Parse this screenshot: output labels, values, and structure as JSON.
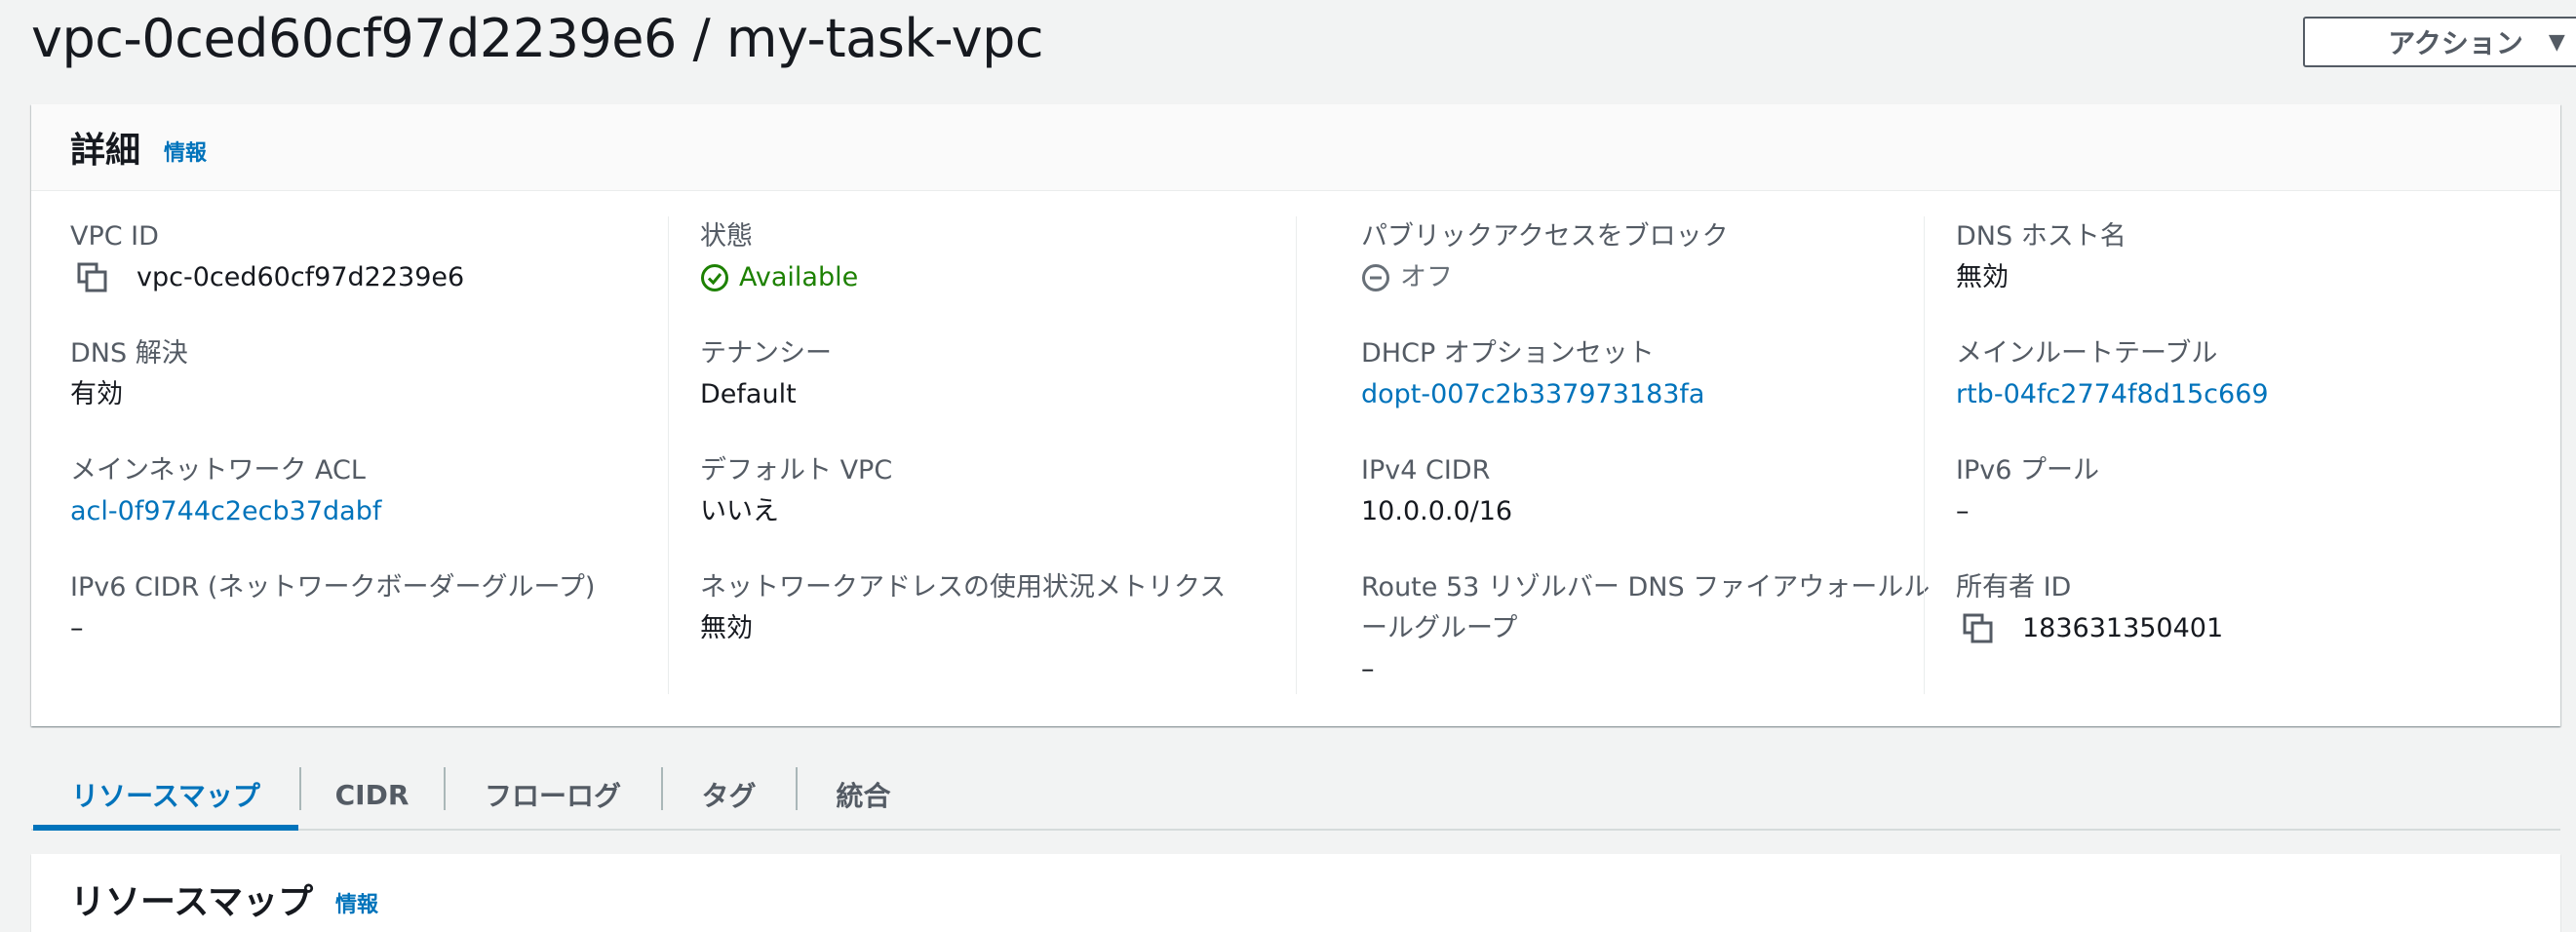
{
  "header": {
    "title": "vpc-0ced60cf97d2239e6 / my-task-vpc",
    "action_label": "アクション"
  },
  "details": {
    "title": "詳細",
    "info": "情報",
    "vpc_id": {
      "label": "VPC ID",
      "value": "vpc-0ced60cf97d2239e6"
    },
    "state": {
      "label": "状態",
      "value": "Available"
    },
    "block_public_access": {
      "label": "パブリックアクセスをブロック",
      "value": "オフ"
    },
    "dns_hostnames": {
      "label": "DNS ホスト名",
      "value": "無効"
    },
    "dns_resolution": {
      "label": "DNS 解決",
      "value": "有効"
    },
    "tenancy": {
      "label": "テナンシー",
      "value": "Default"
    },
    "dhcp_options": {
      "label": "DHCP オプションセット",
      "value": "dopt-007c2b337973183fa"
    },
    "main_route_table": {
      "label": "メインルートテーブル",
      "value": "rtb-04fc2774f8d15c669"
    },
    "main_network_acl": {
      "label": "メインネットワーク ACL",
      "value": "acl-0f9744c2ecb37dabf"
    },
    "default_vpc": {
      "label": "デフォルト VPC",
      "value": "いいえ"
    },
    "ipv4_cidr": {
      "label": "IPv4 CIDR",
      "value": "10.0.0.0/16"
    },
    "ipv6_pool": {
      "label": "IPv6 プール",
      "value": "–"
    },
    "ipv6_cidr": {
      "label": "IPv6 CIDR (ネットワークボーダーグループ)",
      "value": "–"
    },
    "network_address_metrics": {
      "label": "ネットワークアドレスの使用状況メトリクス",
      "value": "無効"
    },
    "route53_firewall": {
      "label_line1": "Route 53 リゾルバー DNS ファイアウォールル",
      "label_line2": "ールグループ",
      "value": "–"
    },
    "owner_id": {
      "label": "所有者 ID",
      "value": "183631350401"
    }
  },
  "tabs": [
    {
      "label": "リソースマップ",
      "active": true
    },
    {
      "label": "CIDR"
    },
    {
      "label": "フローログ"
    },
    {
      "label": "タグ"
    },
    {
      "label": "統合"
    }
  ],
  "resource_map": {
    "title": "リソースマップ",
    "info": "情報"
  },
  "colors": {
    "link": "#0073bb",
    "available": "#1d8102",
    "background": "#f2f3f3"
  }
}
